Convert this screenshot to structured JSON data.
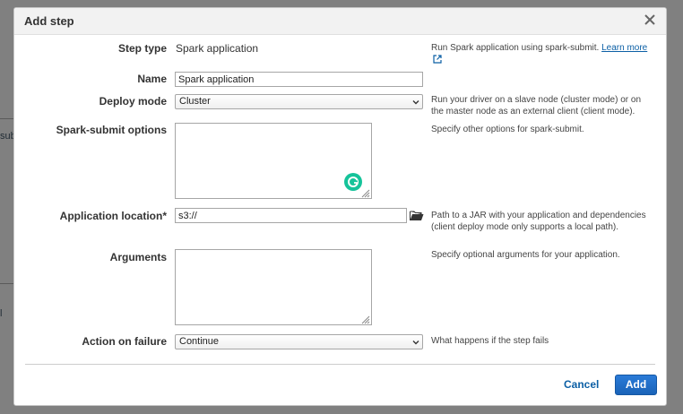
{
  "background": {
    "fragment_left": "sub",
    "fragment_left2": "l"
  },
  "modal": {
    "title": "Add step",
    "close_label": "×"
  },
  "form": {
    "step_type": {
      "label": "Step type",
      "value": "Spark application",
      "help_text": "Run Spark application using spark-submit.",
      "help_link": "Learn more"
    },
    "name": {
      "label": "Name",
      "value": "Spark application"
    },
    "deploy_mode": {
      "label": "Deploy mode",
      "selected": "Cluster",
      "help": "Run your driver on a slave node (cluster mode) or on the master node as an external client (client mode)."
    },
    "spark_submit": {
      "label": "Spark-submit options",
      "value": "",
      "help": "Specify other options for spark-submit."
    },
    "app_location": {
      "label": "Application location*",
      "value": "s3://",
      "help": "Path to a JAR with your application and dependencies (client deploy mode only supports a local path)."
    },
    "arguments": {
      "label": "Arguments",
      "value": "",
      "help": "Specify optional arguments for your application."
    },
    "action_on_failure": {
      "label": "Action on failure",
      "selected": "Continue",
      "help": "What happens if the step fails"
    }
  },
  "footer": {
    "cancel_label": "Cancel",
    "add_label": "Add"
  },
  "colors": {
    "primary": "#1a63b8",
    "link": "#0b5fa5",
    "grammarly": "#15c39a"
  },
  "icons": {
    "close": "close-icon",
    "external": "external-link-icon",
    "folder": "folder-icon",
    "grammarly": "grammarly-icon",
    "chevron": "chevron-down-icon"
  }
}
